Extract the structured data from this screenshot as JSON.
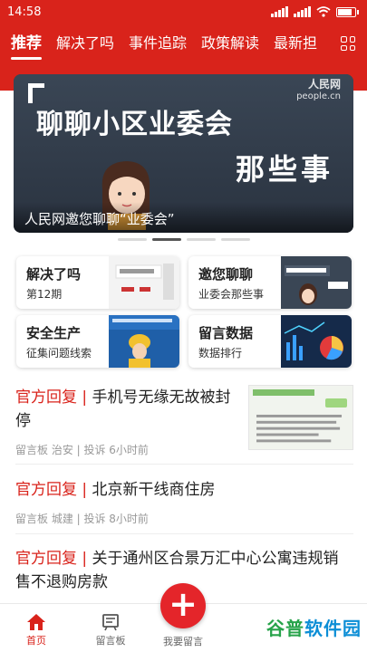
{
  "status": {
    "time": "14:58"
  },
  "tabs": [
    "推荐",
    "解决了吗",
    "事件追踪",
    "政策解读",
    "最新担"
  ],
  "banner": {
    "logo_text": "人民网",
    "logo_sub": "people.cn",
    "title_line1": "聊聊小区业委会",
    "title_line2": "那些事",
    "caption": "人民网邀您聊聊“业委会”"
  },
  "cards": [
    {
      "title": "解决了吗",
      "subtitle": "第12期"
    },
    {
      "title": "邀您聊聊",
      "subtitle": "业委会那些事"
    },
    {
      "title": "安全生产",
      "subtitle": "征集问题线索"
    },
    {
      "title": "留言数据",
      "subtitle": "数据排行"
    }
  ],
  "news": [
    {
      "tag": "官方回复",
      "sep": "|",
      "text": "手机号无缘无故被封停",
      "meta": "留言板  治安 | 投诉   6小时前"
    },
    {
      "tag": "官方回复",
      "sep": "|",
      "text": "北京新干线商住房",
      "meta": "留言板  城建 | 投诉   8小时前"
    },
    {
      "tag": "官方回复",
      "sep": "|",
      "text": "关于通州区合景万汇中心公寓违规销售不退购房款",
      "meta": ""
    }
  ],
  "bottom_nav": {
    "home": "首页",
    "board": "留言板",
    "post": "我要留言"
  },
  "watermark": {
    "part1": "谷普",
    "part2": "软件园"
  },
  "colors": {
    "brand_red": "#d9231b"
  }
}
